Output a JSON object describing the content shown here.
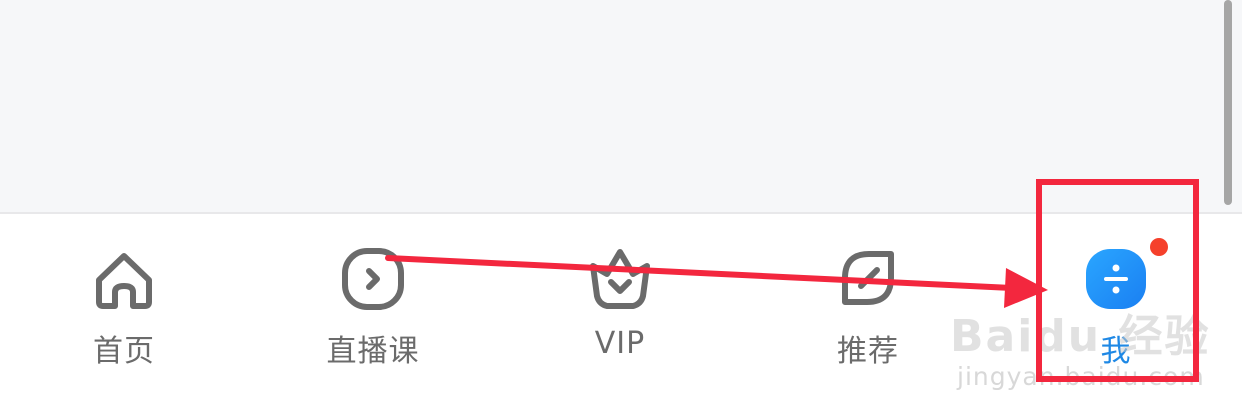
{
  "colors": {
    "accent": "#1e88e5",
    "annotation": "#f3273e",
    "badge": "#f5402b",
    "icon_gray": "#6b6b6b"
  },
  "tabbar": {
    "items": [
      {
        "label": "首页",
        "icon": "home-icon"
      },
      {
        "label": "直播课",
        "icon": "play-circle-icon"
      },
      {
        "label": "VIP",
        "icon": "crown-icon"
      },
      {
        "label": "推荐",
        "icon": "recommend-icon"
      },
      {
        "label": "我",
        "icon": "profile-icon",
        "active": true,
        "has_badge": true
      }
    ]
  },
  "watermark": {
    "brand": "Baidu 经验",
    "url": "jingyan.baidu.com"
  }
}
